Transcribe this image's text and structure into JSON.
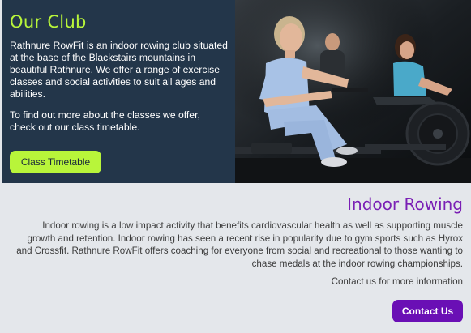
{
  "club": {
    "title": "Our Club",
    "description": "Rathnure RowFit is an indoor rowing club situated at the base of the Blackstairs mountains in beautiful Rathnure. We offer a range of exercise classes and social activities to suit all ages and abilities.",
    "cta_text": "To find out more about the classes we offer, check out our class timetable.",
    "timetable_button": "Class Timetable"
  },
  "rowing": {
    "title": "Indoor Rowing",
    "description": "Indoor rowing is a low impact activity that benefits cardiovascular health as well as supporting muscle growth and retention. Indoor rowing has seen a recent rise in popularity due to gym sports such as Hyrox and Crossfit. Rathnure RowFit offers coaching for everyone from social and recreational to those wanting to chase medals at the indoor rowing championships.",
    "contact_text": "Contact us for more information",
    "contact_button": "Contact Us"
  },
  "colors": {
    "panel_bg": "#23364a",
    "accent_green": "#b8f53a",
    "accent_purple": "#6a0fb5",
    "section_bg": "#e4e7eb"
  }
}
